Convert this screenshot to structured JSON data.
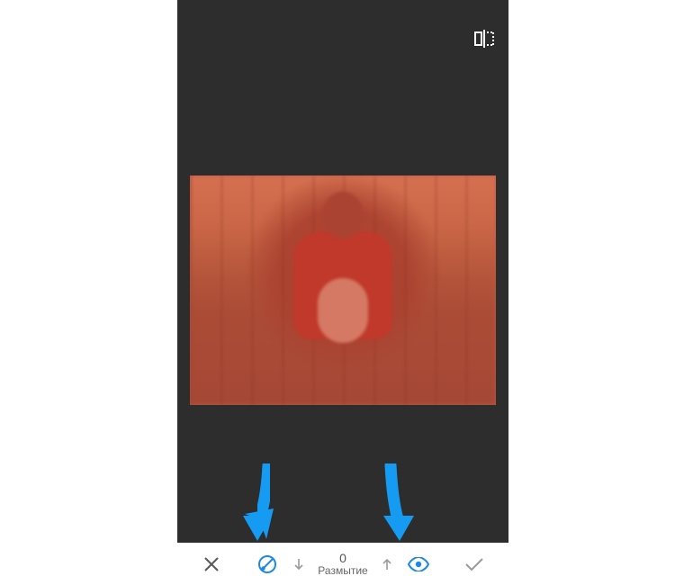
{
  "topbar": {
    "compare_icon": "compare-icon"
  },
  "canvas": {
    "mask_color": "#e13c2d",
    "mask_opacity": 0.48
  },
  "toolbar": {
    "cancel_icon": "close-icon",
    "brush_icon": "brush-icon",
    "decrease_icon": "arrow-down-icon",
    "increase_icon": "arrow-up-icon",
    "value": "0",
    "label": "Размытие",
    "preview_icon": "eye-icon",
    "confirm_icon": "check-icon",
    "accent_color": "#1e88e5",
    "muted_color": "#9a9a9a"
  },
  "annotations": {
    "arrow_color": "#169bf2"
  }
}
